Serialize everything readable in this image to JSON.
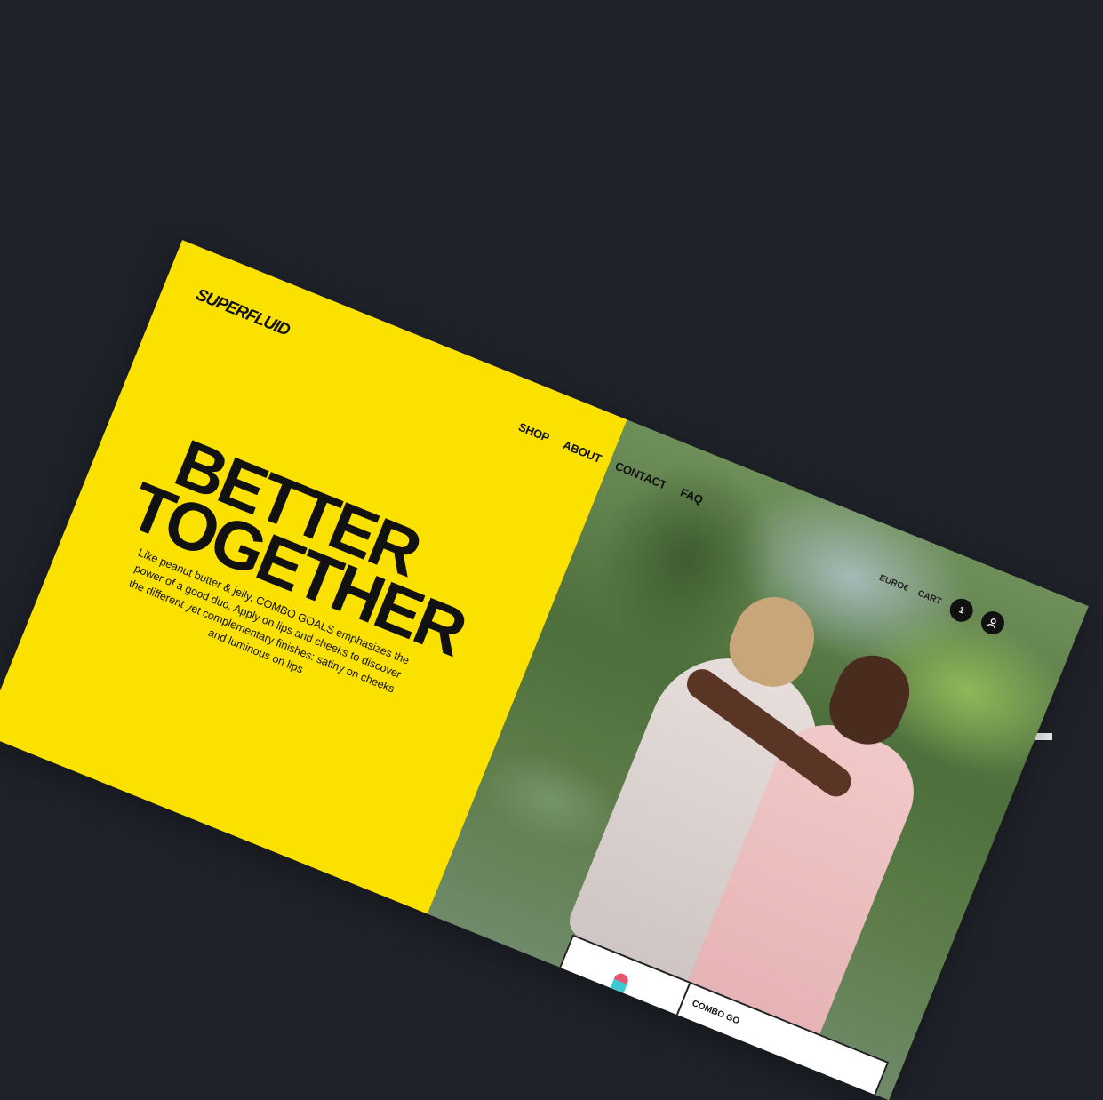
{
  "site": {
    "logo": "SUPERFLUID",
    "nav": [
      "SHOP",
      "ABOUT",
      "CONTACT",
      "FAQ"
    ],
    "region": "EURO€",
    "cart_label": "CART",
    "cart_count": "1"
  },
  "hero": {
    "headline_line1": "BETTER",
    "headline_line2": "TOGETHER",
    "description": "Like peanut butter & jelly, COMBO GOALS emphasizes the power of a good duo. Apply on lips and cheeks to discover the different yet complementary finishes: satiny on cheeks and luminous on lips"
  },
  "product": {
    "name": "COMBO GO"
  },
  "icons": {
    "account": "user-icon",
    "product": "lipstick-icon"
  },
  "colors": {
    "background": "#1f2229",
    "brand_yellow": "#fae100",
    "text": "#111111"
  }
}
